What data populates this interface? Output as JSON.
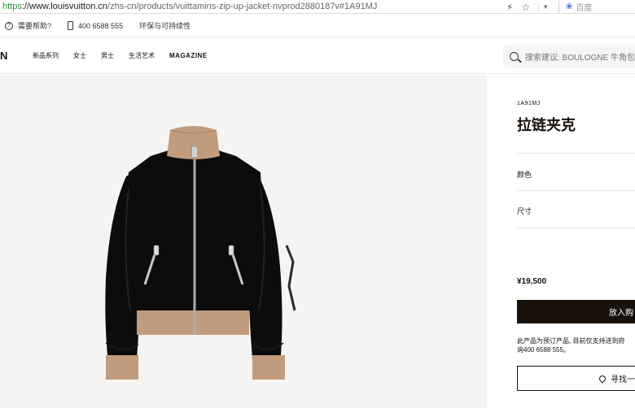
{
  "browser": {
    "url_scheme": "https",
    "url_host": "://www.louisvuitton.cn",
    "url_path": "/zhs-cn/products/vuittamins-zip-up-jacket-nvprod2880187v#1A91MJ",
    "search_placeholder": "百度",
    "icons": [
      "bolt-icon",
      "star-icon",
      "dropdown-icon",
      "baidu-paw-icon"
    ]
  },
  "utility": {
    "help": "需要帮助?",
    "phone": "400 6588 555",
    "sustainability": "环保与可持续性"
  },
  "nav": {
    "logo": "N",
    "items": [
      "新品系列",
      "女士",
      "男士",
      "生活艺术",
      "MAGAZINE"
    ],
    "search_placeholder": "搜索建议: BOULOGNE 牛角包"
  },
  "product": {
    "sku": "1A91MJ",
    "title": "拉链夹克",
    "color_label": "颜色",
    "size_label": "尺寸",
    "price": "¥19,500",
    "buy_label": "放入购",
    "notice_line1": "此产品为预订产品, 目前仅支持送到府",
    "notice_line2": "询400 6588 555。",
    "find_label": "寻找一"
  },
  "colors": {
    "jacket_body": "#0d0c0c",
    "jacket_trim": "#c29c7c",
    "image_bg": "#f5f4f2",
    "button_dark": "#19110b"
  }
}
